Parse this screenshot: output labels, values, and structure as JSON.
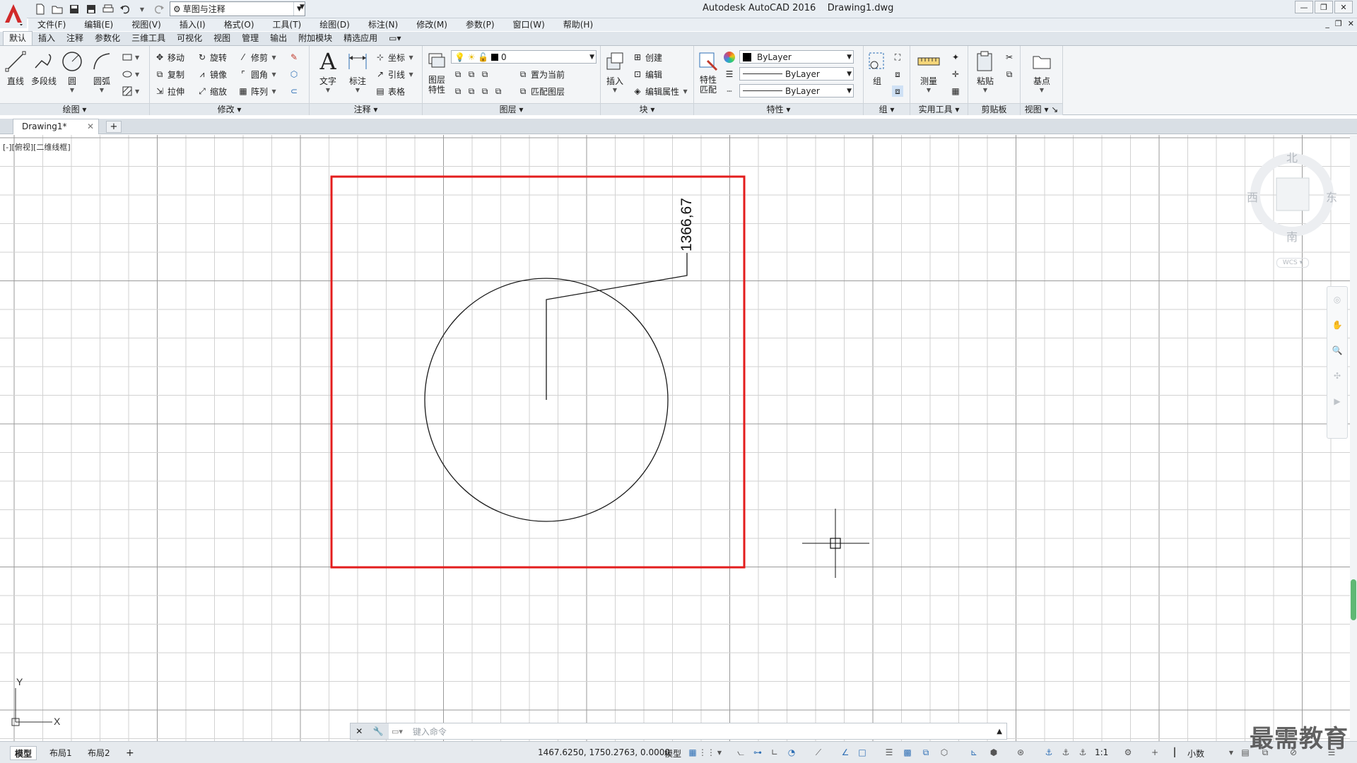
{
  "app": {
    "title": "Autodesk AutoCAD 2016",
    "filename": "Drawing1.dwg",
    "workspace": "草图与注释",
    "logo_letter": "A"
  },
  "menu": [
    "文件(F)",
    "编辑(E)",
    "视图(V)",
    "插入(I)",
    "格式(O)",
    "工具(T)",
    "绘图(D)",
    "标注(N)",
    "修改(M)",
    "参数(P)",
    "窗口(W)",
    "帮助(H)"
  ],
  "ribbon_tabs": [
    "默认",
    "插入",
    "注释",
    "参数化",
    "三维工具",
    "可视化",
    "视图",
    "管理",
    "输出",
    "附加模块",
    "精选应用"
  ],
  "panels": {
    "draw": {
      "title": "绘图",
      "line": "直线",
      "polyline": "多段线",
      "circle": "圆",
      "arc": "圆弧"
    },
    "modify": {
      "title": "修改",
      "move": "移动",
      "rotate": "旋转",
      "trim": "修剪",
      "copy": "复制",
      "mirror": "镜像",
      "fillet": "圆角",
      "stretch": "拉伸",
      "scale": "缩放",
      "array": "阵列"
    },
    "annotation": {
      "title": "注释",
      "text": "文字",
      "dimension": "标注",
      "coordinate": "坐标",
      "leader": "引线",
      "table": "表格"
    },
    "layers": {
      "title": "图层",
      "layer_props": "图层特性",
      "current_layer": "0",
      "set_current": "置为当前",
      "match_layer": "匹配图层"
    },
    "block": {
      "title": "块",
      "insert": "插入",
      "create": "创建",
      "edit": "编辑",
      "edit_attr": "编辑属性"
    },
    "properties": {
      "title": "特性",
      "match": "特性匹配",
      "color": "ByLayer",
      "linetype": "ByLayer",
      "lineweight": "ByLayer"
    },
    "groups": {
      "title": "组",
      "group": "组"
    },
    "utilities": {
      "title": "实用工具",
      "measure": "测量"
    },
    "clipboard": {
      "title": "剪贴板",
      "paste": "粘贴"
    },
    "view": {
      "title": "视图",
      "base": "基点"
    }
  },
  "doc_tab": {
    "name": "Drawing1*"
  },
  "viewport_label": "[-][俯视][二维线框]",
  "viewcube": {
    "north": "北",
    "south": "南",
    "east": "东",
    "west": "西",
    "wcs": "WCS"
  },
  "drawing": {
    "dimension_text": "1366,67",
    "ucs_x": "X",
    "ucs_y": "Y"
  },
  "command": {
    "placeholder": "键入命令"
  },
  "status": {
    "layouts": [
      "模型",
      "布局1",
      "布局2"
    ],
    "coords": "1467.6250, 1750.2763, 0.0000",
    "model": "模型",
    "scale": "1:1",
    "units": "小数"
  },
  "watermark": "最需教育",
  "colors": {
    "accent_red": "#e31d1d",
    "ucs_green": "#5fb874",
    "grid": "#cfcfcf"
  }
}
